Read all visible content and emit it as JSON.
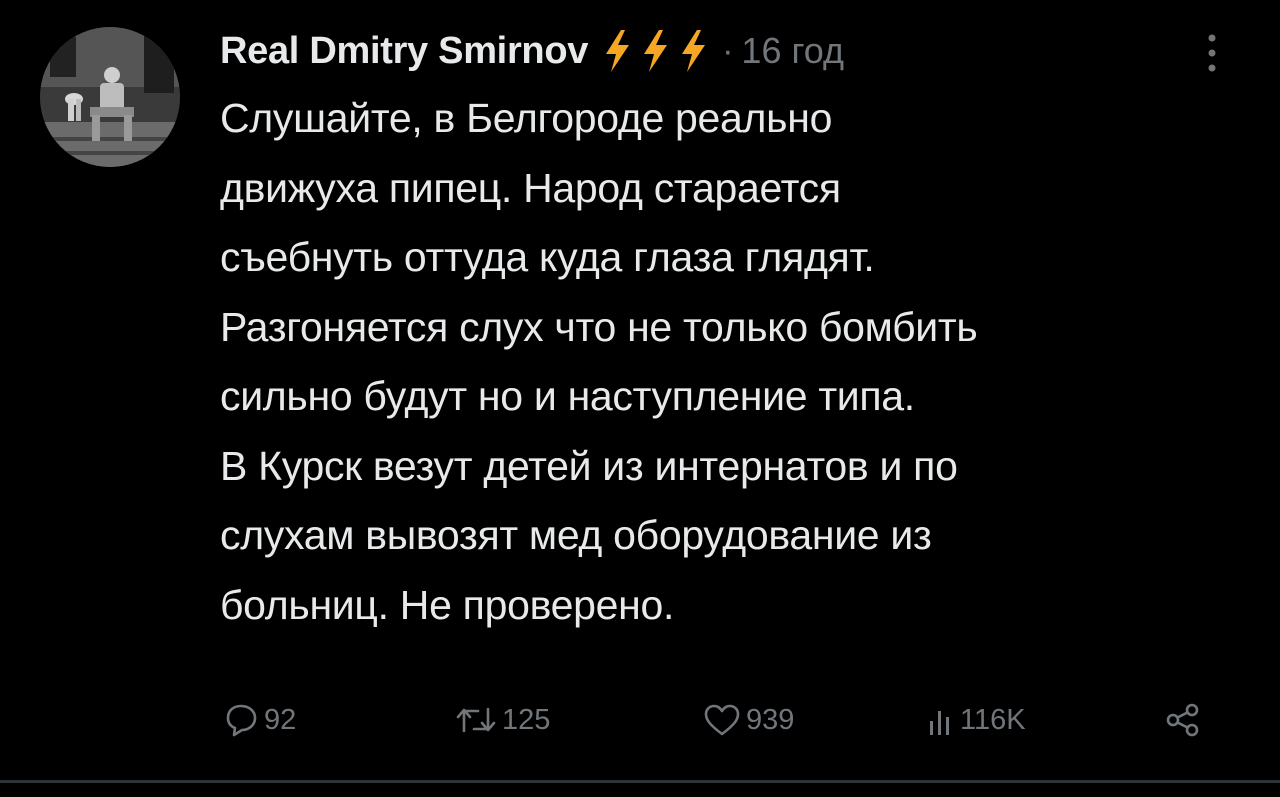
{
  "user": {
    "display_name": "Real Dmitry Smirnov",
    "badge_icons": [
      "lightning-bolt-icon",
      "lightning-bolt-icon",
      "lightning-bolt-icon"
    ],
    "separator": "·",
    "time": "16 год"
  },
  "tweet": {
    "lines": [
      "Слушайте, в Белгороде реально",
      "движуха пипец. Народ старается",
      "съебнуть оттуда куда глаза глядят.",
      "Разгоняется слух что не только бомбить",
      "сильно будут но и наступление типа.",
      "В Курск везут детей из интернатов и по",
      "слухам вывозят мед оборудование из",
      "больниц. Не проверено."
    ]
  },
  "actions": {
    "replies": "92",
    "retweets": "125",
    "likes": "939",
    "views": "116K"
  },
  "colors": {
    "background": "#000000",
    "text": "#e7e9ea",
    "muted": "#71767b",
    "bolt": "#f5a623"
  }
}
